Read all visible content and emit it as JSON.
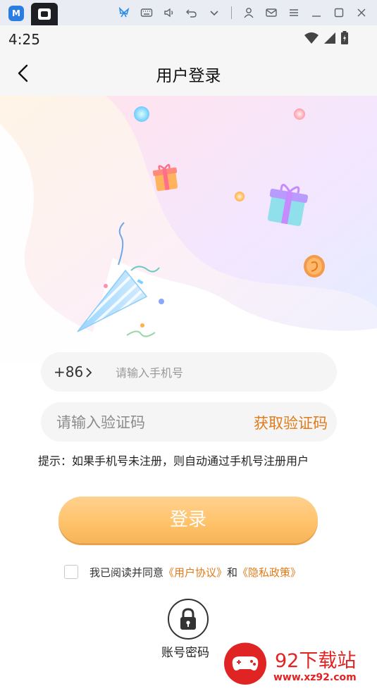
{
  "emulator": {
    "icons": [
      "butterfly-icon",
      "keyboard-icon",
      "volume-icon",
      "undo-icon",
      "chevron-down-icon",
      "user-icon",
      "mail-icon",
      "menu-icon",
      "minimize-icon",
      "maximize-icon",
      "close-icon"
    ]
  },
  "status_bar": {
    "time": "4:25"
  },
  "header": {
    "title": "用户登录"
  },
  "form": {
    "country_code": "+86",
    "phone_placeholder": "请输入手机号",
    "code_placeholder": "请输入验证码",
    "get_code_label": "获取验证码",
    "hint": "提示：如果手机号未注册，则自动通过手机号注册用户",
    "login_label": "登录",
    "agreement_prefix": "我已阅读并同意",
    "user_agreement": "《用户协议》",
    "agreement_and": "和",
    "privacy_policy": "《隐私政策》",
    "password_login_label": "账号密码"
  },
  "watermark": {
    "brand": "92下载站",
    "url": "www.xz92.com"
  },
  "colors": {
    "accent": "#e07b1a",
    "button": "#ffc36b"
  }
}
